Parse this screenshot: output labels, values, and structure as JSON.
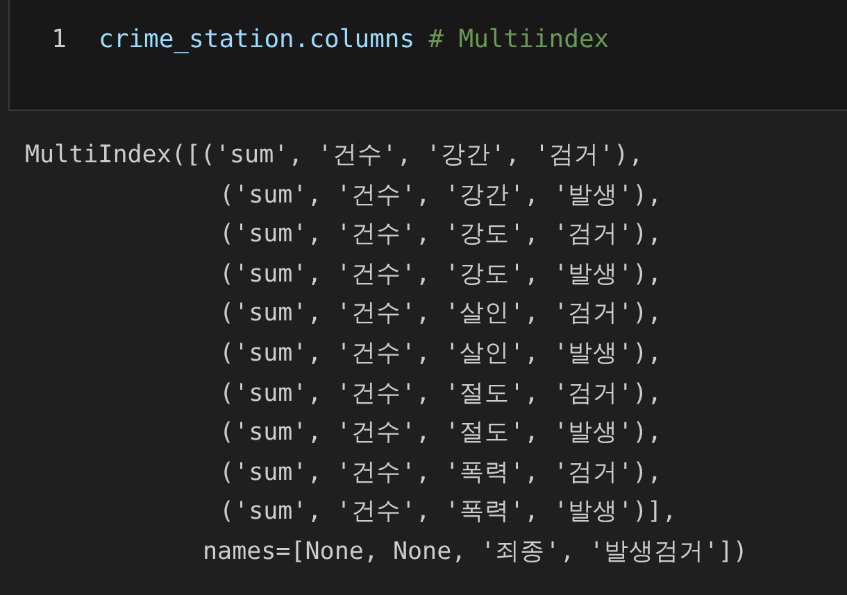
{
  "code_cell": {
    "line_number": "1",
    "tokens": [
      {
        "kind": "code",
        "text": "crime_station.columns"
      },
      {
        "kind": "comment",
        "text": "# Multiindex"
      }
    ]
  },
  "output": {
    "lines": [
      {
        "kind": "first",
        "text": "MultiIndex([('sum', '건수', '강간', '검거'),"
      },
      {
        "kind": "tuple",
        "text": "('sum', '건수', '강간', '발생'),"
      },
      {
        "kind": "tuple",
        "text": "('sum', '건수', '강도', '검거'),"
      },
      {
        "kind": "tuple",
        "text": "('sum', '건수', '강도', '발생'),"
      },
      {
        "kind": "tuple",
        "text": "('sum', '건수', '살인', '검거'),"
      },
      {
        "kind": "tuple",
        "text": "('sum', '건수', '살인', '발생'),"
      },
      {
        "kind": "tuple",
        "text": "('sum', '건수', '절도', '검거'),"
      },
      {
        "kind": "tuple",
        "text": "('sum', '건수', '절도', '발생'),"
      },
      {
        "kind": "tuple",
        "text": "('sum', '건수', '폭력', '검거'),"
      },
      {
        "kind": "tuple",
        "text": "('sum', '건수', '폭력', '발생')],"
      },
      {
        "kind": "names",
        "text": "names=[None, None, '죄종', '발생검거'])"
      }
    ]
  }
}
